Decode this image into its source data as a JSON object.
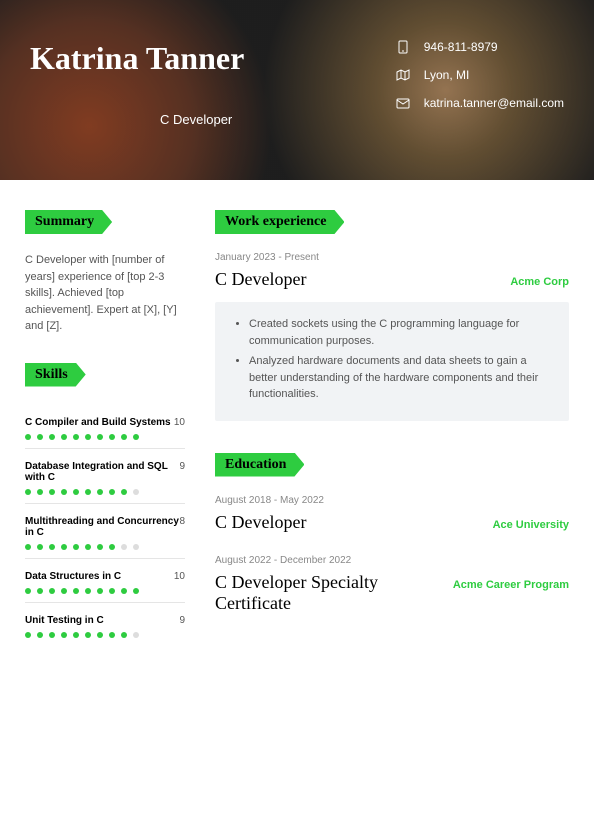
{
  "header": {
    "name": "Katrina Tanner",
    "title": "C Developer",
    "phone": "946-811-8979",
    "location": "Lyon, MI",
    "email": "katrina.tanner@email.com"
  },
  "sections": {
    "summary": "Summary",
    "skills": "Skills",
    "work": "Work experience",
    "education": "Education"
  },
  "summary_text": "C Developer with [number of years] experience of [top 2-3 skills]. Achieved [top achievement]. Expert at [X], [Y] and [Z].",
  "skills": [
    {
      "name": "C Compiler and Build Systems",
      "score": "10",
      "fill": 10
    },
    {
      "name": "Database Integration and SQL with C",
      "score": "9",
      "fill": 9
    },
    {
      "name": "Multithreading and Concurrency in C",
      "score": "8",
      "fill": 8
    },
    {
      "name": "Data Structures in C",
      "score": "10",
      "fill": 10
    },
    {
      "name": "Unit Testing in C",
      "score": "9",
      "fill": 9
    }
  ],
  "work": [
    {
      "dates": "January 2023 - Present",
      "title": "C Developer",
      "company": "Acme Corp",
      "bullets": [
        "Created sockets using the C programming language for communication purposes.",
        "Analyzed hardware documents and data sheets to gain a better understanding of the hardware components and their functionalities."
      ]
    }
  ],
  "education": [
    {
      "dates": "August 2018 - May 2022",
      "title": "C Developer",
      "company": "Ace University"
    },
    {
      "dates": "August 2022 - December 2022",
      "title": "C Developer Specialty Certificate",
      "company": "Acme Career Program"
    }
  ]
}
